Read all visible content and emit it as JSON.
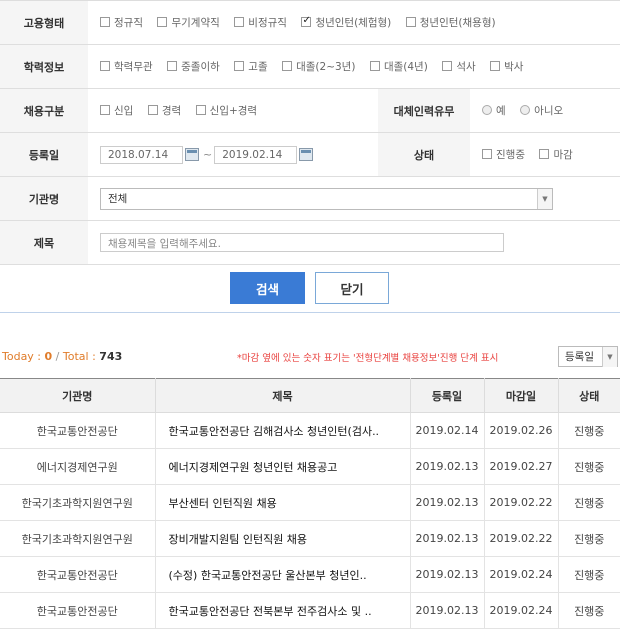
{
  "search": {
    "employment": {
      "label": "고용형태",
      "options": [
        {
          "label": "정규직",
          "checked": false
        },
        {
          "label": "무기계약직",
          "checked": false
        },
        {
          "label": "비정규직",
          "checked": false
        },
        {
          "label": "청년인턴(체험형)",
          "checked": true
        },
        {
          "label": "청년인턴(채용형)",
          "checked": false
        }
      ]
    },
    "education": {
      "label": "학력정보",
      "options": [
        {
          "label": "학력무관",
          "checked": false
        },
        {
          "label": "중졸이하",
          "checked": false
        },
        {
          "label": "고졸",
          "checked": false
        },
        {
          "label": "대졸(2~3년)",
          "checked": false
        },
        {
          "label": "대졸(4년)",
          "checked": false
        },
        {
          "label": "석사",
          "checked": false
        },
        {
          "label": "박사",
          "checked": false
        }
      ]
    },
    "hiring_type": {
      "label": "채용구분",
      "options": [
        {
          "label": "신입",
          "checked": false
        },
        {
          "label": "경력",
          "checked": false
        },
        {
          "label": "신입+경력",
          "checked": false
        }
      ]
    },
    "replacement": {
      "label": "대체인력유무",
      "options": [
        {
          "label": "예",
          "selected": false
        },
        {
          "label": "아니오",
          "selected": false
        }
      ]
    },
    "reg_date": {
      "label": "등록일",
      "from": "2018.07.14",
      "to": "2019.02.14",
      "separator": "~"
    },
    "status": {
      "label": "상태",
      "options": [
        {
          "label": "진행중",
          "checked": false
        },
        {
          "label": "마감",
          "checked": false
        }
      ]
    },
    "agency": {
      "label": "기관명",
      "value": "전체"
    },
    "title": {
      "label": "제목",
      "placeholder": "채용제목을 입력해주세요."
    },
    "search_button": "검색",
    "close_button": "닫기"
  },
  "summary": {
    "today_label": "Today :",
    "today_value": "0",
    "sep": "/",
    "total_label": "Total :",
    "total_value": "743"
  },
  "note": "*마감 옆에 있는 숫자 표기는 '전형단계별 채용정보'진행 단계 표시",
  "sort": {
    "value": "등록일"
  },
  "list": {
    "headers": [
      "기관명",
      "제목",
      "등록일",
      "마감일",
      "상태"
    ],
    "rows": [
      {
        "agency": "한국교통안전공단",
        "title": "한국교통안전공단 김해검사소 청년인턴(검사..",
        "reg": "2019.02.14",
        "due": "2019.02.26",
        "status": "진행중"
      },
      {
        "agency": "에너지경제연구원",
        "title": "에너지경제연구원 청년인턴 채용공고",
        "reg": "2019.02.13",
        "due": "2019.02.27",
        "status": "진행중"
      },
      {
        "agency": "한국기초과학지원연구원",
        "title": "부산센터 인턴직원 채용",
        "reg": "2019.02.13",
        "due": "2019.02.22",
        "status": "진행중"
      },
      {
        "agency": "한국기초과학지원연구원",
        "title": "장비개발지원팀 인턴직원 채용",
        "reg": "2019.02.13",
        "due": "2019.02.22",
        "status": "진행중"
      },
      {
        "agency": "한국교통안전공단",
        "title": "(수정) 한국교통안전공단 울산본부 청년인..",
        "reg": "2019.02.13",
        "due": "2019.02.24",
        "status": "진행중"
      },
      {
        "agency": "한국교통안전공단",
        "title": "한국교통안전공단 전북본부 전주검사소 및 ..",
        "reg": "2019.02.13",
        "due": "2019.02.24",
        "status": "진행중"
      }
    ]
  }
}
